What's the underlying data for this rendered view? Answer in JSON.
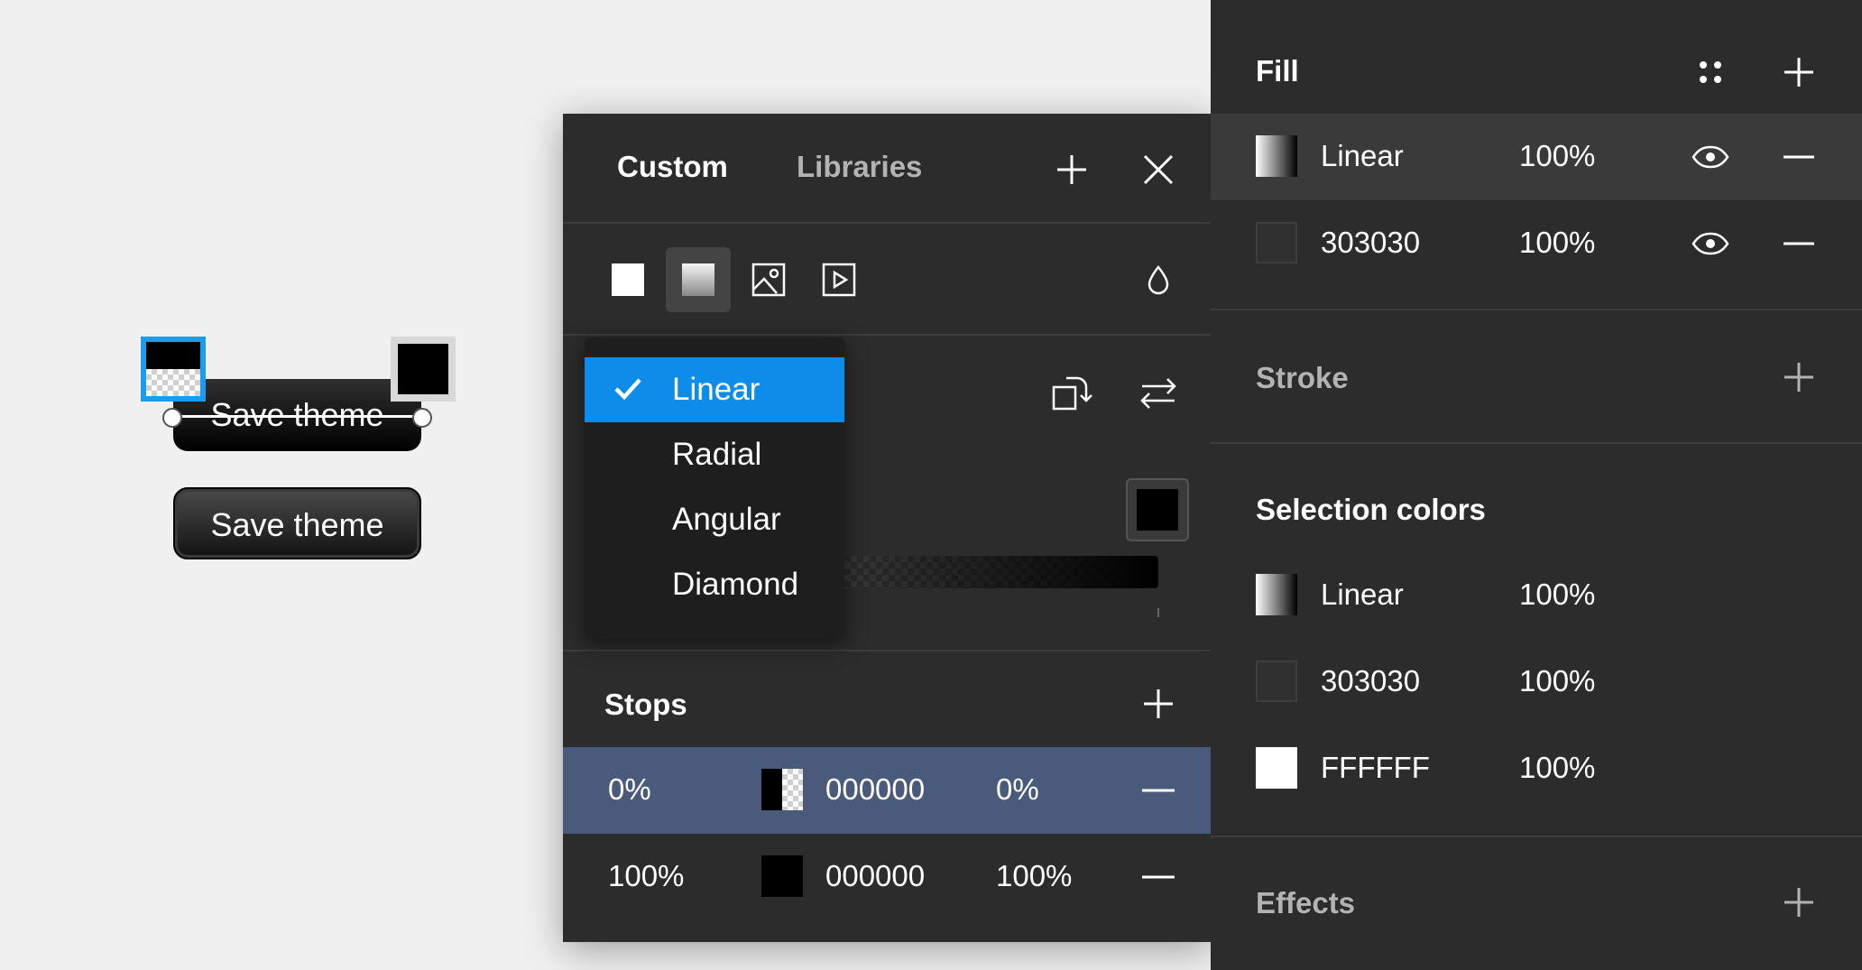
{
  "canvas": {
    "button_label": "Save theme",
    "button_label_2": "Save theme"
  },
  "picker": {
    "tabs": {
      "custom": "Custom",
      "libraries": "Libraries"
    },
    "fill_types": [
      "solid",
      "gradient",
      "image",
      "video"
    ],
    "dropdown": {
      "selected": "Linear",
      "options": [
        "Linear",
        "Radial",
        "Angular",
        "Diamond"
      ]
    },
    "stops": {
      "title": "Stops",
      "rows": [
        {
          "position": "0%",
          "hex": "000000",
          "opacity": "0%"
        },
        {
          "position": "100%",
          "hex": "000000",
          "opacity": "100%"
        }
      ]
    },
    "colors": {
      "accent": "#0d8ce9",
      "row_selected": "#4a5a7a"
    }
  },
  "props": {
    "fill": {
      "title": "Fill",
      "rows": [
        {
          "name": "Linear",
          "opacity": "100%"
        },
        {
          "name": "303030",
          "opacity": "100%"
        }
      ]
    },
    "stroke": {
      "title": "Stroke"
    },
    "selection_colors": {
      "title": "Selection colors",
      "rows": [
        {
          "name": "Linear",
          "opacity": "100%"
        },
        {
          "name": "303030",
          "opacity": "100%"
        },
        {
          "name": "FFFFFF",
          "opacity": "100%"
        }
      ]
    },
    "effects": {
      "title": "Effects"
    }
  }
}
